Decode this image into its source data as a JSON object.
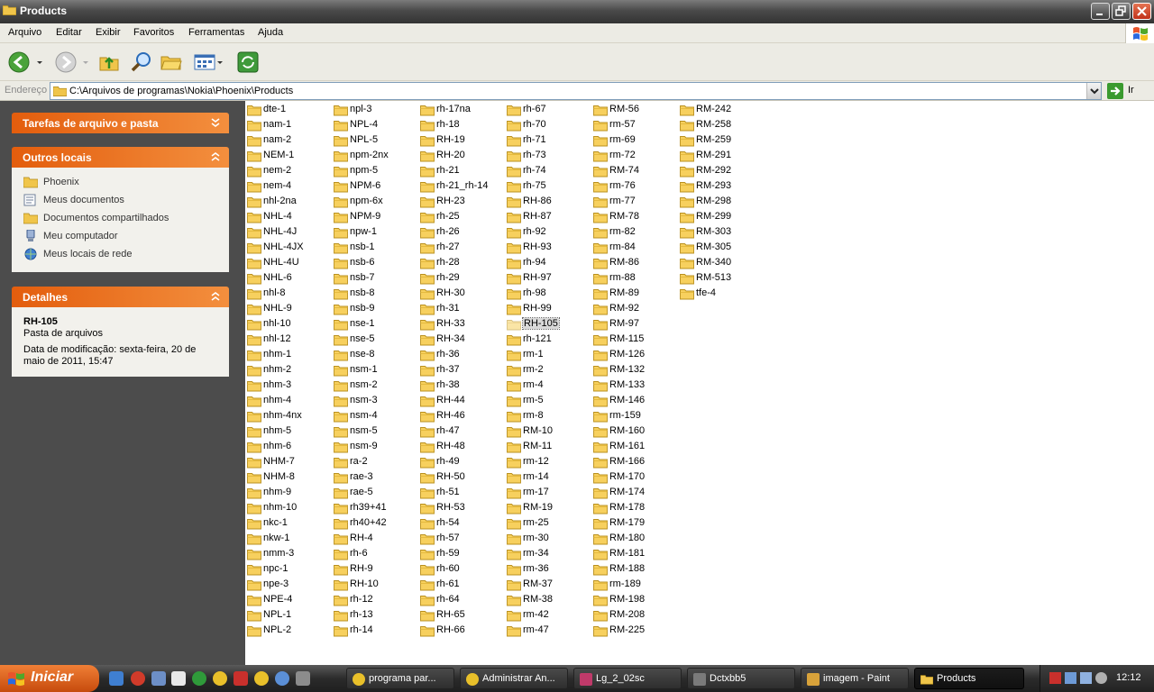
{
  "window": {
    "title": "Products"
  },
  "menu": [
    "Arquivo",
    "Editar",
    "Exibir",
    "Favoritos",
    "Ferramentas",
    "Ajuda"
  ],
  "address": {
    "label": "Endereço",
    "path": "C:\\Arquivos de programas\\Nokia\\Phoenix\\Products",
    "go_label": "Ir"
  },
  "panels": {
    "tasks": {
      "title": "Tarefas de arquivo e pasta"
    },
    "other": {
      "title": "Outros locais",
      "items": [
        "Phoenix",
        "Meus documentos",
        "Documentos compartilhados",
        "Meu computador",
        "Meus locais de rede"
      ]
    },
    "details": {
      "title": "Detalhes",
      "name": "RH-105",
      "type": "Pasta de arquivos",
      "modified_line1": "Data de modificação: sexta-feira, 20 de",
      "modified_line2": "maio de 2011, 15:47"
    }
  },
  "folders": [
    [
      "dte-1",
      "nam-1",
      "nam-2",
      "NEM-1",
      "nem-2",
      "nem-4",
      "nhl-2na",
      "NHL-4",
      "NHL-4J",
      "NHL-4JX",
      "NHL-4U",
      "NHL-6",
      "nhl-8",
      "NHL-9",
      "nhl-10",
      "nhl-12",
      "nhm-1",
      "nhm-2",
      "nhm-3",
      "nhm-4",
      "nhm-4nx",
      "nhm-5",
      "nhm-6",
      "NHM-7",
      "NHM-8",
      "nhm-9",
      "nhm-10",
      "nkc-1",
      "nkw-1",
      "nmm-3",
      "npc-1",
      "npe-3",
      "NPE-4",
      "NPL-1",
      "NPL-2"
    ],
    [
      "npl-3",
      "NPL-4",
      "NPL-5",
      "npm-2nx",
      "npm-5",
      "NPM-6",
      "npm-6x",
      "NPM-9",
      "npw-1",
      "nsb-1",
      "nsb-6",
      "nsb-7",
      "nsb-8",
      "nsb-9",
      "nse-1",
      "nse-5",
      "nse-8",
      "nsm-1",
      "nsm-2",
      "nsm-3",
      "nsm-4",
      "nsm-5",
      "nsm-9",
      "ra-2",
      "rae-3",
      "rae-5",
      "rh39+41",
      "rh40+42",
      "RH-4",
      "rh-6",
      "RH-9",
      "RH-10",
      "rh-12",
      "rh-13",
      "rh-14"
    ],
    [
      "rh-17na",
      "rh-18",
      "RH-19",
      "RH-20",
      "rh-21",
      "rh-21_rh-14",
      "RH-23",
      "rh-25",
      "rh-26",
      "rh-27",
      "rh-28",
      "rh-29",
      "RH-30",
      "rh-31",
      "RH-33",
      "RH-34",
      "rh-36",
      "rh-37",
      "rh-38",
      "RH-44",
      "RH-46",
      "rh-47",
      "RH-48",
      "rh-49",
      "RH-50",
      "rh-51",
      "RH-53",
      "rh-54",
      "rh-57",
      "rh-59",
      "rh-60",
      "rh-61",
      "rh-64",
      "RH-65",
      "RH-66"
    ],
    [
      "rh-67",
      "rh-70",
      "rh-71",
      "rh-73",
      "rh-74",
      "rh-75",
      "RH-86",
      "RH-87",
      "rh-92",
      "RH-93",
      "rh-94",
      "RH-97",
      "rh-98",
      "RH-99",
      "RH-105",
      "rh-121",
      "rm-1",
      "rm-2",
      "rm-4",
      "rm-5",
      "rm-8",
      "RM-10",
      "RM-11",
      "rm-12",
      "rm-14",
      "rm-17",
      "RM-19",
      "rm-25",
      "rm-30",
      "rm-34",
      "rm-36",
      "RM-37",
      "RM-38",
      "rm-42",
      "rm-47"
    ],
    [
      "RM-56",
      "rm-57",
      "rm-69",
      "rm-72",
      "RM-74",
      "rm-76",
      "rm-77",
      "RM-78",
      "rm-82",
      "rm-84",
      "RM-86",
      "rm-88",
      "RM-89",
      "RM-92",
      "RM-97",
      "RM-115",
      "RM-126",
      "RM-132",
      "RM-133",
      "RM-146",
      "rm-159",
      "RM-160",
      "RM-161",
      "RM-166",
      "RM-170",
      "RM-174",
      "RM-178",
      "RM-179",
      "RM-180",
      "RM-181",
      "RM-188",
      "rm-189",
      "RM-198",
      "RM-208",
      "RM-225"
    ],
    [
      "RM-242",
      "RM-258",
      "RM-259",
      "RM-291",
      "RM-292",
      "RM-293",
      "RM-298",
      "RM-299",
      "RM-303",
      "RM-305",
      "RM-340",
      "RM-513",
      "tfe-4"
    ]
  ],
  "selected_folder": "RH-105",
  "taskbar": {
    "start_label": "Iniciar",
    "tasks": [
      "programa par...",
      "Administrar An...",
      "Lg_2_02sc",
      "Dctxbb5",
      "imagem - Paint",
      "Products"
    ],
    "active_task": "Products",
    "clock": "12:12"
  }
}
